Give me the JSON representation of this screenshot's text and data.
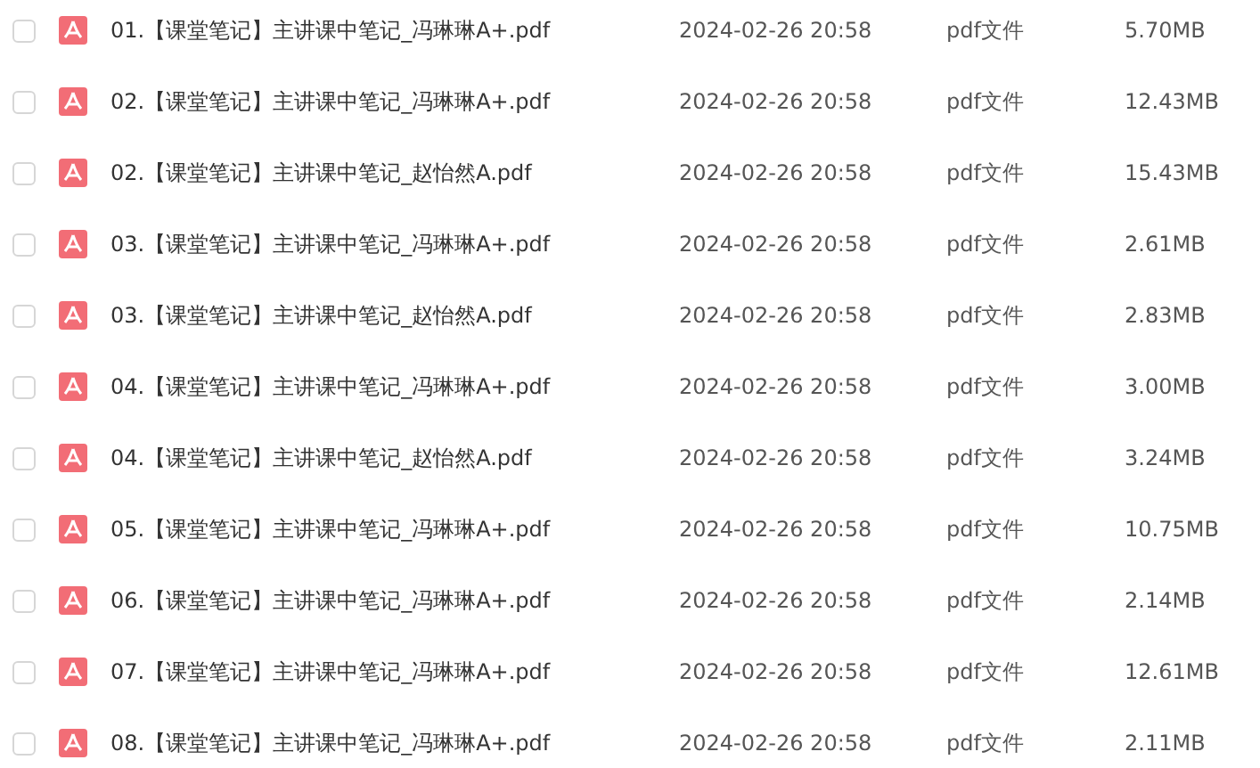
{
  "files": [
    {
      "name": "01.【课堂笔记】主讲课中笔记_冯琳琳A+.pdf",
      "date": "2024-02-26 20:58",
      "type": "pdf文件",
      "size": "5.70MB",
      "checked": false
    },
    {
      "name": "02.【课堂笔记】主讲课中笔记_冯琳琳A+.pdf",
      "date": "2024-02-26 20:58",
      "type": "pdf文件",
      "size": "12.43MB",
      "checked": false
    },
    {
      "name": "02.【课堂笔记】主讲课中笔记_赵怡然A.pdf",
      "date": "2024-02-26 20:58",
      "type": "pdf文件",
      "size": "15.43MB",
      "checked": false
    },
    {
      "name": "03.【课堂笔记】主讲课中笔记_冯琳琳A+.pdf",
      "date": "2024-02-26 20:58",
      "type": "pdf文件",
      "size": "2.61MB",
      "checked": false
    },
    {
      "name": "03.【课堂笔记】主讲课中笔记_赵怡然A.pdf",
      "date": "2024-02-26 20:58",
      "type": "pdf文件",
      "size": "2.83MB",
      "checked": false
    },
    {
      "name": "04.【课堂笔记】主讲课中笔记_冯琳琳A+.pdf",
      "date": "2024-02-26 20:58",
      "type": "pdf文件",
      "size": "3.00MB",
      "checked": false
    },
    {
      "name": "04.【课堂笔记】主讲课中笔记_赵怡然A.pdf",
      "date": "2024-02-26 20:58",
      "type": "pdf文件",
      "size": "3.24MB",
      "checked": false
    },
    {
      "name": "05.【课堂笔记】主讲课中笔记_冯琳琳A+.pdf",
      "date": "2024-02-26 20:58",
      "type": "pdf文件",
      "size": "10.75MB",
      "checked": false
    },
    {
      "name": "06.【课堂笔记】主讲课中笔记_冯琳琳A+.pdf",
      "date": "2024-02-26 20:58",
      "type": "pdf文件",
      "size": "2.14MB",
      "checked": false
    },
    {
      "name": "07.【课堂笔记】主讲课中笔记_冯琳琳A+.pdf",
      "date": "2024-02-26 20:58",
      "type": "pdf文件",
      "size": "12.61MB",
      "checked": false
    },
    {
      "name": "08.【课堂笔记】主讲课中笔记_冯琳琳A+.pdf",
      "date": "2024-02-26 20:58",
      "type": "pdf文件",
      "size": "2.11MB",
      "checked": false
    }
  ]
}
